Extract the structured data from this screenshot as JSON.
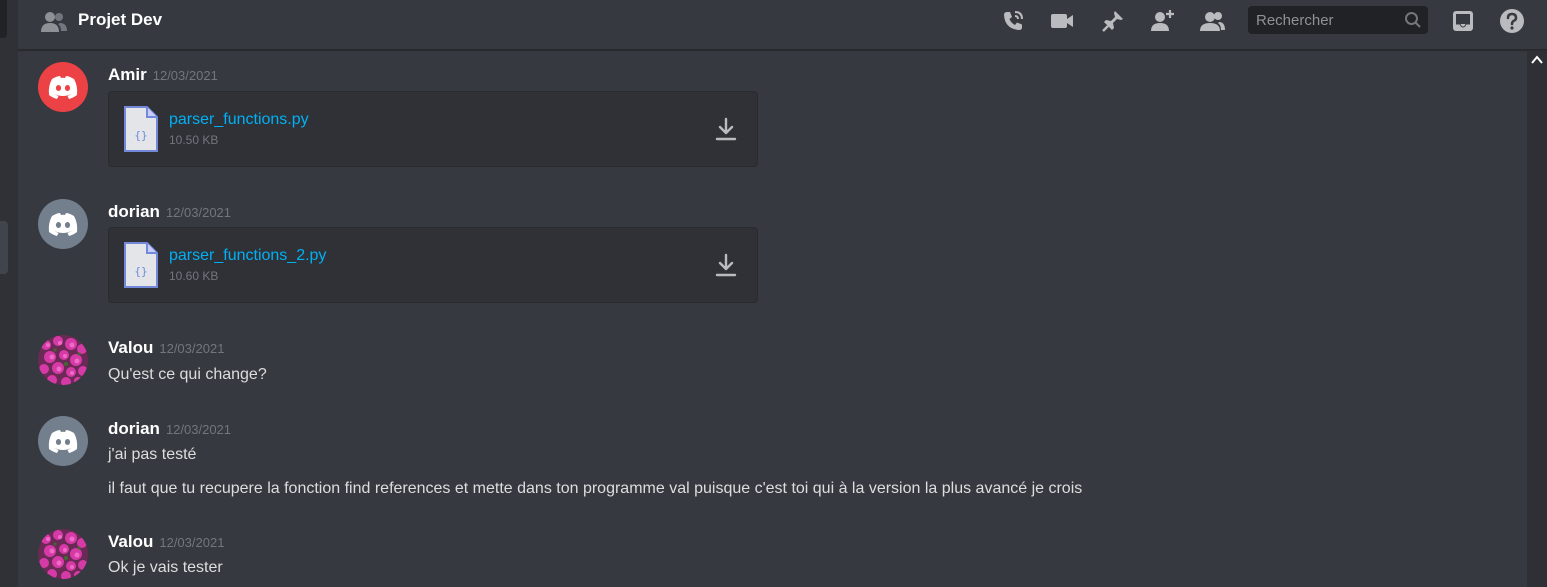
{
  "header": {
    "title": "Projet Dev",
    "search_placeholder": "Rechercher",
    "icons": [
      "call-icon",
      "video-icon",
      "pin-icon",
      "add-member-icon",
      "members-icon",
      "search-icon",
      "inbox-icon",
      "help-icon"
    ]
  },
  "colors": {
    "background": "#36393f",
    "header_text": "#ffffff",
    "link": "#00b0f4",
    "timestamp": "#72767d",
    "avatar_red": "#ed4245",
    "avatar_grey": "#747f8d"
  },
  "messages": [
    {
      "author": "Amir",
      "timestamp": "12/03/2021",
      "avatar": "discord-red",
      "attachment": {
        "filename": "parser_functions.py",
        "size": "10.50 KB"
      }
    },
    {
      "author": "dorian",
      "timestamp": "12/03/2021",
      "avatar": "discord-grey",
      "attachment": {
        "filename": "parser_functions_2.py",
        "size": "10.60 KB"
      }
    },
    {
      "author": "Valou",
      "timestamp": "12/03/2021",
      "avatar": "flower-photo",
      "lines": [
        "Qu'est ce qui change?"
      ]
    },
    {
      "author": "dorian",
      "timestamp": "12/03/2021",
      "avatar": "discord-grey",
      "lines": [
        "j'ai pas testé",
        "il faut que tu recupere la fonction find references et mette dans ton programme val puisque c'est toi qui à la version la plus avancé je crois"
      ]
    },
    {
      "author": "Valou",
      "timestamp": "12/03/2021",
      "avatar": "flower-photo",
      "lines": [
        "Ok je vais tester"
      ]
    }
  ]
}
